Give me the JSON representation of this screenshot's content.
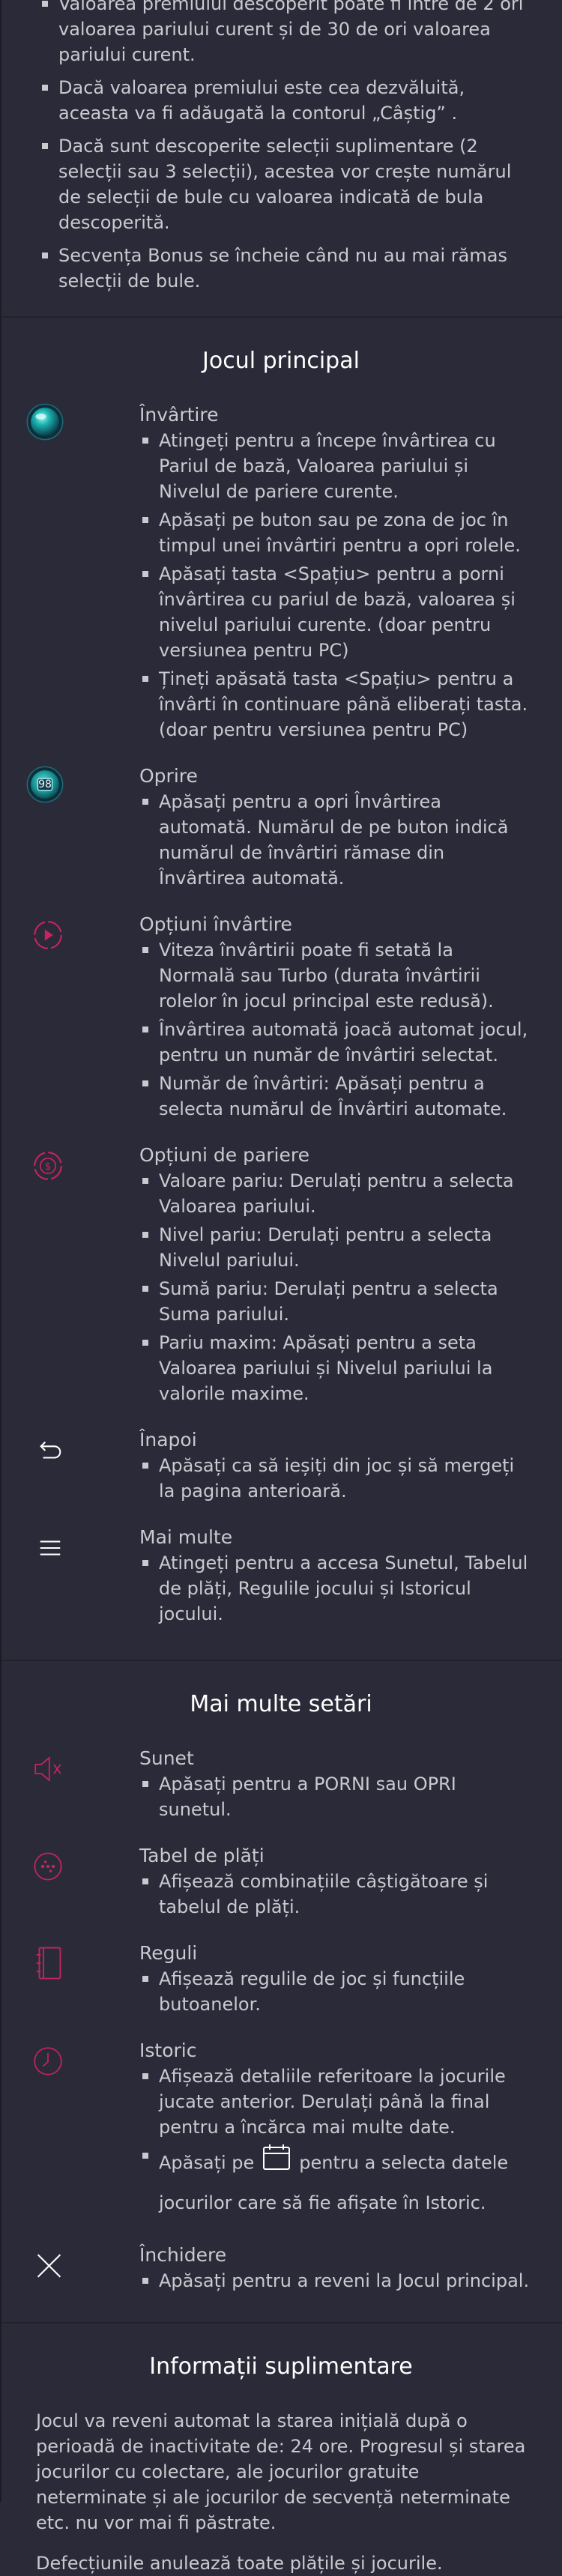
{
  "intro_bullets": [
    "Valoarea premiului descoperit poate fi între de 2 ori valoarea pariului curent și de 30 de ori valoarea pariului curent.",
    "Dacă valoarea premiului este cea dezvăluită, aceasta va fi adăugată la contorul „Câștig” .",
    "Dacă sunt descoperite selecții suplimentare (2 selecții sau 3 selecții), acestea vor crește numărul de selecții de bule cu valoarea indicată de bula descoperită.",
    "Secvența Bonus se încheie când nu au mai rămas selecții de bule."
  ],
  "main_game": {
    "title": "Jocul principal",
    "items": [
      {
        "icon": "spin-icon",
        "title": "Învârtire",
        "bullets": [
          "Atingeți pentru a începe învârtirea cu Pariul de bază, Valoarea pariului și Nivelul de pariere curente.",
          "Apăsați pe buton sau pe zona de joc în timpul unei învârtiri pentru a opri rolele.",
          "Apăsați tasta <Spațiu> pentru a porni învârtirea cu pariul de bază, valoarea și nivelul pariului curente. (doar pentru versiunea pentru PC)",
          "Țineți apăsată tasta <Spațiu> pentru a învârti în continuare până eliberați tasta. (doar pentru versiunea pentru PC)"
        ]
      },
      {
        "icon": "stop-icon",
        "icon_text": "98",
        "title": "Oprire",
        "bullets": [
          "Apăsați pentru a opri Învârtirea automată. Numărul de pe buton indică numărul de învârtiri rămase din Învârtirea automată."
        ]
      },
      {
        "icon": "spin-options-icon",
        "title": "Opțiuni învârtire",
        "bullets": [
          "Viteza învârtirii poate fi setată la Normală sau Turbo (durata învârtirii rolelor în jocul principal este redusă).",
          "Învârtirea automată joacă automat jocul, pentru un număr de învârtiri selectat.",
          "Număr de învârtiri: Apăsați pentru a selecta numărul de Învârtiri automate."
        ]
      },
      {
        "icon": "bet-options-icon",
        "title": "Opțiuni de pariere",
        "bullets": [
          "Valoare pariu: Derulați pentru a selecta Valoarea pariului.",
          "Nivel pariu: Derulați pentru a selecta Nivelul pariului.",
          "Sumă pariu: Derulați pentru a selecta Suma pariului.",
          "Pariu maxim: Apăsați pentru a seta Valoarea pariului și Nivelul pariului la valorile maxime."
        ]
      },
      {
        "icon": "back-icon",
        "title": "Înapoi",
        "bullets": [
          "Apăsați ca să ieșiți din joc și să mergeți la pagina anterioară."
        ]
      },
      {
        "icon": "menu-icon",
        "title": "Mai multe",
        "bullets": [
          "Atingeți pentru a accesa Sunetul, Tabelul de plăți, Regulile jocului și Istoricul jocului."
        ]
      }
    ]
  },
  "more_settings": {
    "title": "Mai multe setări",
    "items": [
      {
        "icon": "sound-icon",
        "title": "Sunet",
        "bullets": [
          "Apăsați pentru a PORNI sau OPRI sunetul."
        ]
      },
      {
        "icon": "paytable-icon",
        "title": "Tabel de plăți",
        "bullets": [
          "Afișează combinațiile câștigătoare și tabelul de plăți."
        ]
      },
      {
        "icon": "rules-icon",
        "title": "Reguli",
        "bullets": [
          "Afișează regulile de joc și funcțiile butoanelor."
        ]
      },
      {
        "icon": "history-icon",
        "title": "Istoric",
        "bullets": [
          "Afișează detaliile referitoare la jocurile jucate anterior. Derulați până la final pentru a încărca mai multe date."
        ],
        "calendar_before": "Apăsați pe",
        "calendar_after": "pentru a selecta datele jocurilor care să fie afișate în Istoric."
      },
      {
        "icon": "close-icon",
        "title": "Închidere",
        "bullets": [
          "Apăsați pentru a reveni la Jocul principal."
        ]
      }
    ]
  },
  "additional_info": {
    "title": "Informații suplimentare",
    "paragraphs": [
      "Jocul va reveni automat la starea inițială după o perioadă de inactivitate de: 24 ore. Progresul și starea jocurilor cu colectare, ale jocurilor gratuite neterminate și ale jocurilor de secvență neterminate etc. nu vor mai fi păstrate.",
      "Defecțiunile anulează toate plățile și jocurile."
    ]
  },
  "colors": {
    "background": "#2b2a38",
    "accent": "#c6245e",
    "text": "#c9c9cf",
    "title": "#ffffff"
  }
}
